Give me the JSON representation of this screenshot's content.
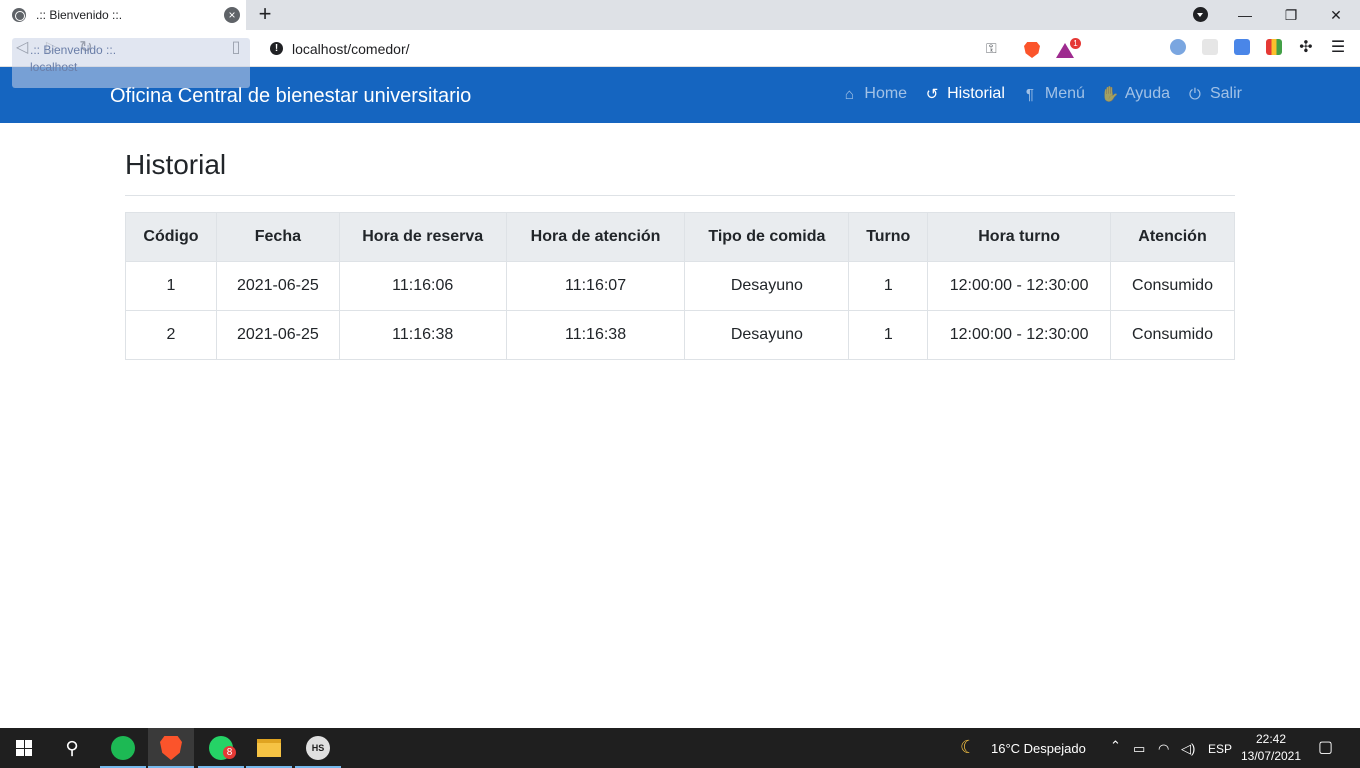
{
  "browser": {
    "tab_title": ".:: Bienvenido ::.",
    "close_glyph": "×",
    "newtab_glyph": "+",
    "url": "localhost/comedor/",
    "tooltip": {
      "title": ".:: Bienvenido ::.",
      "subtitle": "localhost"
    },
    "notification_badge": "1",
    "window_controls": {
      "minimize": "—",
      "restore": "❐",
      "close": "✕"
    }
  },
  "app": {
    "brand": "Oficina Central de bienestar universitario",
    "nav": [
      {
        "label": "Home",
        "icon": "home-icon",
        "glyph": "⌂",
        "active": false
      },
      {
        "label": "Historial",
        "icon": "history-icon",
        "glyph": "↺",
        "active": true
      },
      {
        "label": "Menú",
        "icon": "utensils-icon",
        "glyph": "¶",
        "active": false
      },
      {
        "label": "Ayuda",
        "icon": "handshake-icon",
        "glyph": "✋",
        "active": false
      },
      {
        "label": "Salir",
        "icon": "power-icon",
        "glyph": "⏻",
        "active": false
      }
    ]
  },
  "page": {
    "title": "Historial",
    "table": {
      "headers": [
        "Código",
        "Fecha",
        "Hora de reserva",
        "Hora de atención",
        "Tipo de comida",
        "Turno",
        "Hora turno",
        "Atención"
      ],
      "rows": [
        [
          "1",
          "2021-06-25",
          "11:16:06",
          "11:16:07",
          "Desayuno",
          "1",
          "12:00:00 - 12:30:00",
          "Consumido"
        ],
        [
          "2",
          "2021-06-25",
          "11:16:38",
          "11:16:38",
          "Desayuno",
          "1",
          "12:00:00 - 12:30:00",
          "Consumido"
        ]
      ]
    }
  },
  "taskbar": {
    "weather": "16°C  Despejado",
    "language": "ESP",
    "time": "22:42",
    "date": "13/07/2021",
    "whatsapp_badge": "8",
    "hs_label": "HS"
  },
  "colors": {
    "navbar": "#1565c0",
    "table_header": "#e9ecef",
    "taskbar": "#1f1f1f"
  }
}
